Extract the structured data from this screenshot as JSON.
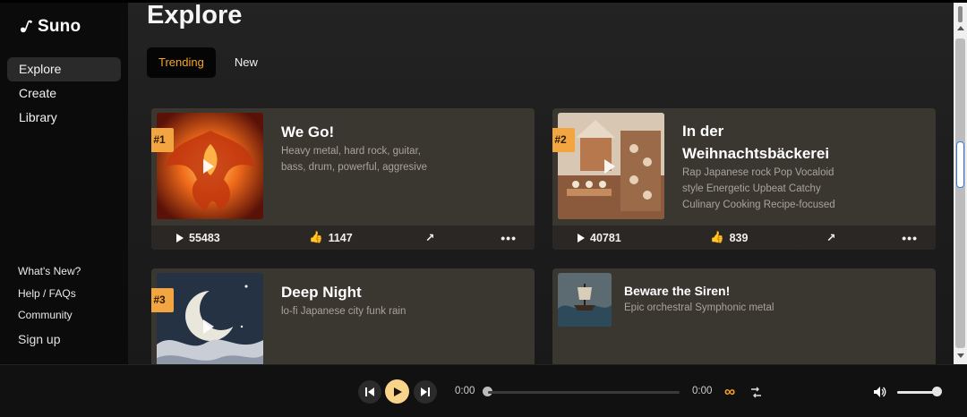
{
  "sidebar": {
    "logo": "Suno",
    "nav": [
      "Explore",
      "Create",
      "Library"
    ],
    "bottom_links": [
      "What's New?",
      "Help / FAQs",
      "Community",
      "Sign up"
    ]
  },
  "main": {
    "title": "Explore",
    "tabs": [
      "Trending",
      "New"
    ]
  },
  "songs": [
    {
      "rank": "#1",
      "title": "We Go!",
      "desc": "Heavy metal, hard rock, guitar, bass, drum, powerful, aggresive",
      "plays": "55483",
      "likes": "1147"
    },
    {
      "rank": "#2",
      "title_line1": "In der",
      "title_line2": "Weihnachtsbäckerei",
      "desc": "Rap Japanese rock Pop Vocaloid style Energetic Upbeat Catchy Culinary Cooking Recipe-focused",
      "plays": "40781",
      "likes": "839"
    },
    {
      "rank": "#3",
      "title": "Deep Night",
      "desc": "lo-fi Japanese city funk rain"
    },
    {
      "title": "Beware the Siren!",
      "desc": "Epic orchestral Symphonic metal"
    }
  ],
  "player": {
    "time_current": "0:00",
    "time_total": "0:00",
    "loop_icon": "∞"
  },
  "colors": {
    "accent": "#f6a623",
    "rank_badge": "#f2a540",
    "card_bg": "#3a3630"
  }
}
